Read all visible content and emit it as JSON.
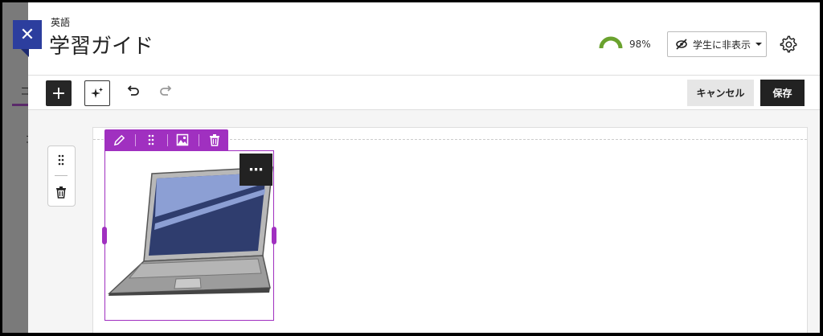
{
  "background": {
    "text1": "コ",
    "text2": "コ"
  },
  "close_button": {
    "icon": "close-icon",
    "glyph": "✕"
  },
  "header": {
    "course_name": "英語",
    "title": "学習ガイド",
    "progress_percent": 98,
    "progress_label": "98%",
    "visibility_label": "学生に非表示",
    "gauge_color": "#6aa22e"
  },
  "toolbar": {
    "add_glyph": "+",
    "cancel_label": "キャンセル",
    "save_label": "保存"
  },
  "image_block": {
    "more_glyph": "⋯",
    "resize_color": "#a030c0"
  },
  "colors": {
    "accent_purple": "#a030c0",
    "close_blue": "#2c3e9e",
    "dark_button": "#222222"
  }
}
